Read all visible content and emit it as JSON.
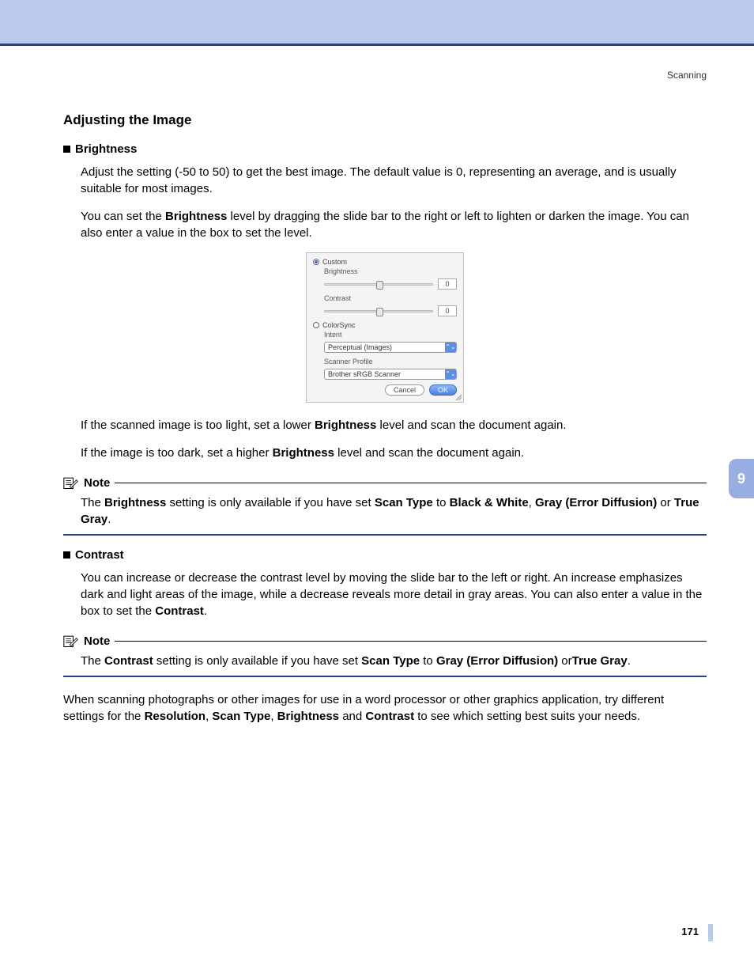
{
  "header": {
    "section": "Scanning"
  },
  "title": "Adjusting the Image",
  "brightness": {
    "label": "Brightness",
    "p1": "Adjust the setting (-50 to 50) to get the best image. The default value is 0, representing an average, and is usually suitable for most images.",
    "p2a": "You can set the ",
    "p2b": "Brightness",
    "p2c": " level by dragging the slide bar to the right or left to lighten or darken the image. You can also enter a value in the box to set the level.",
    "p3a": "If the scanned image is too light, set a lower ",
    "p3b": "Brightness",
    "p3c": " level and scan the document again.",
    "p4a": "If the image is too dark, set a higher ",
    "p4b": "Brightness",
    "p4c": " level and scan the document again."
  },
  "note1": {
    "title": "Note",
    "t1": "The ",
    "b1": "Brightness",
    "t2": " setting is only available if you have set ",
    "b2": "Scan Type",
    "t3": " to ",
    "b3": "Black & White",
    "t4": ", ",
    "b4": "Gray (Error Diffusion)",
    "t5": " or ",
    "b5": "True Gray",
    "t6": "."
  },
  "contrast": {
    "label": "Contrast",
    "p1a": "You can increase or decrease the contrast level by moving the slide bar to the left or right. An increase emphasizes dark and light areas of the image, while a decrease reveals more detail in gray areas. You can also enter a value in the box to set the ",
    "p1b": "Contrast",
    "p1c": "."
  },
  "note2": {
    "title": "Note",
    "t1": "The ",
    "b1": "Contrast",
    "t2": " setting is only available if you have set ",
    "b2": "Scan Type",
    "t3": " to ",
    "b3": "Gray (Error Diffusion)",
    "t4": " or",
    "b4": "True Gray",
    "t5": "."
  },
  "closing": {
    "t1": "When scanning photographs or other images for use in a word processor or other graphics application, try different settings for the ",
    "b1": "Resolution",
    "t2": ", ",
    "b2": "Scan Type",
    "t3": ", ",
    "b3": "Brightness",
    "t4": " and ",
    "b4": "Contrast",
    "t5": " to see which setting best suits your needs."
  },
  "dialog": {
    "custom": "Custom",
    "brightness": "Brightness",
    "contrast": "Contrast",
    "brightness_val": "0",
    "contrast_val": "0",
    "colorsync": "ColorSync",
    "intent": "Intent",
    "intent_val": "Perceptual (Images)",
    "profile": "Scanner Profile",
    "profile_val": "Brother sRGB Scanner",
    "cancel": "Cancel",
    "ok": "OK"
  },
  "chapter": "9",
  "page": "171"
}
